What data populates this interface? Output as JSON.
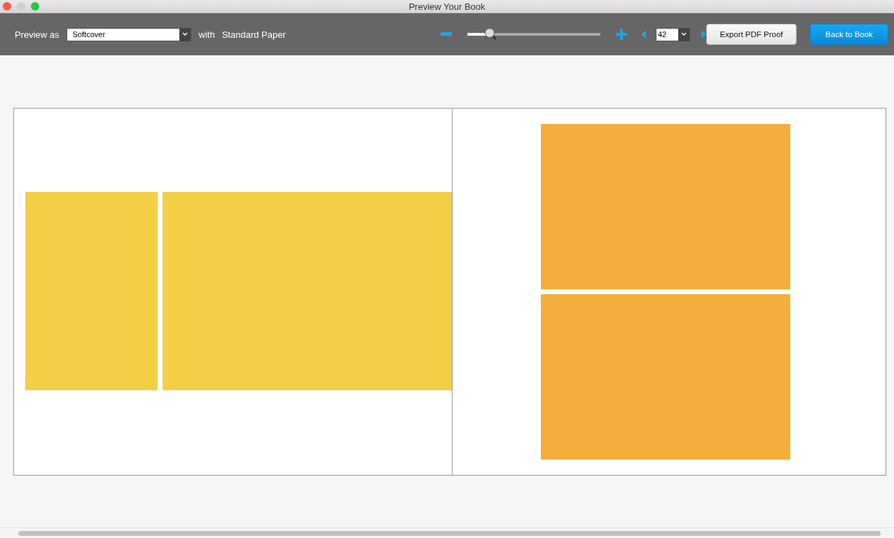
{
  "window": {
    "title": "Preview Your Book"
  },
  "toolbar": {
    "preview_label": "Preview as",
    "cover": "Softcover",
    "with_label": "with",
    "paper": "Standard Paper",
    "zoom": {
      "level": 0.17
    },
    "page": "42",
    "export_button": "Export PDF Proof",
    "back_button": "Back to Book"
  },
  "spread": {
    "left_page": {
      "kind": "row",
      "frames": [
        {
          "color": "#f2cf44"
        },
        {
          "color": "#f2cf44"
        }
      ]
    },
    "right_page": {
      "kind": "column",
      "frames": [
        {
          "color": "#f5ae3b"
        },
        {
          "color": "#f5ae3b"
        }
      ]
    }
  }
}
